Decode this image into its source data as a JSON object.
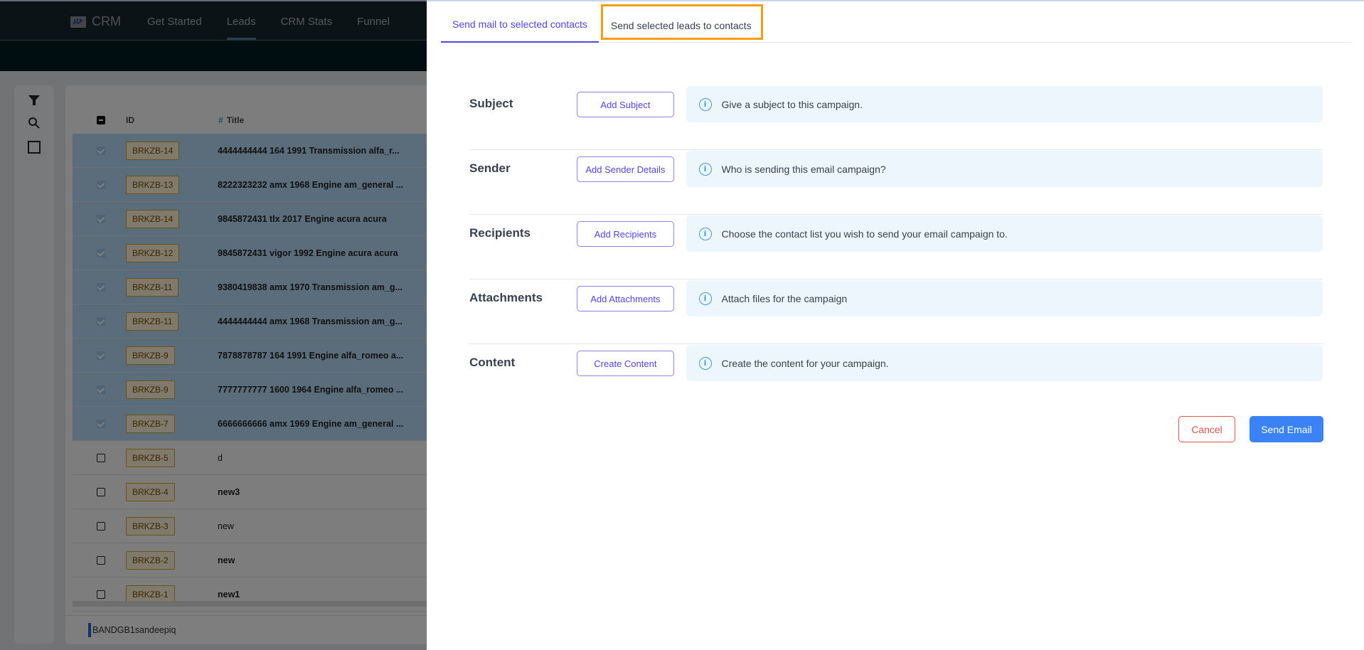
{
  "app": {
    "brand": "CRM",
    "nav": [
      {
        "label": "Get Started",
        "active": false
      },
      {
        "label": "Leads",
        "active": true
      },
      {
        "label": "CRM Stats",
        "active": false
      },
      {
        "label": "Funnel",
        "active": false
      }
    ]
  },
  "side_rail": {
    "icons": [
      "filter-icon",
      "search-icon",
      "square-icon"
    ]
  },
  "grid": {
    "columns": {
      "id": "ID",
      "title_hash": "#",
      "title": "Title"
    },
    "rows": [
      {
        "id": "BRKZB-14",
        "title": "4444444444 164 1991 Transmission alfa_r...",
        "selected": true,
        "bold": true
      },
      {
        "id": "BRKZB-13",
        "title": "8222323232 amx 1968 Engine am_general ...",
        "selected": true,
        "bold": true
      },
      {
        "id": "BRKZB-14",
        "title": "9845872431 tlx 2017 Engine acura acura",
        "selected": true,
        "bold": true
      },
      {
        "id": "BRKZB-12",
        "title": "9845872431 vigor 1992 Engine acura acura",
        "selected": true,
        "bold": true
      },
      {
        "id": "BRKZB-11",
        "title": "9380419838 amx 1970 Transmission am_g...",
        "selected": true,
        "bold": true
      },
      {
        "id": "BRKZB-11",
        "title": "4444444444 amx 1968 Transmission am_g...",
        "selected": true,
        "bold": true
      },
      {
        "id": "BRKZB-9",
        "title": "7878878787 164 1991 Engine alfa_romeo a...",
        "selected": true,
        "bold": true
      },
      {
        "id": "BRKZB-9",
        "title": "7777777777 1600 1964 Engine alfa_romeo ...",
        "selected": true,
        "bold": true
      },
      {
        "id": "BRKZB-7",
        "title": "6666666666 amx 1969 Engine am_general ...",
        "selected": true,
        "bold": true
      },
      {
        "id": "BRKZB-5",
        "title": "d",
        "selected": false,
        "bold": false
      },
      {
        "id": "BRKZB-4",
        "title": "new3",
        "selected": false,
        "bold": true
      },
      {
        "id": "BRKZB-3",
        "title": "new",
        "selected": false,
        "bold": false
      },
      {
        "id": "BRKZB-2",
        "title": "new",
        "selected": false,
        "bold": true
      },
      {
        "id": "BRKZB-1",
        "title": "new1",
        "selected": false,
        "bold": true
      }
    ],
    "footer": "BANDGB1sandeepiq"
  },
  "dialog": {
    "tabs": [
      {
        "label": "Send mail to selected contacts",
        "active": true
      },
      {
        "label": "Send selected leads to contacts",
        "active": false,
        "highlighted": true
      }
    ],
    "sections": [
      {
        "label": "Subject",
        "button": "Add Subject",
        "info": "Give a subject to this campaign."
      },
      {
        "label": "Sender",
        "button": "Add Sender Details",
        "info": "Who is sending this email campaign?"
      },
      {
        "label": "Recipients",
        "button": "Add Recipients",
        "info": "Choose the contact list you wish to send your email campaign to."
      },
      {
        "label": "Attachments",
        "button": "Add Attachments",
        "info": "Attach files for the campaign"
      },
      {
        "label": "Content",
        "button": "Create Content",
        "info": "Create the content for your campaign."
      }
    ],
    "info_glyph": "i",
    "cancel_label": "Cancel",
    "send_label": "Send Email"
  },
  "colors": {
    "accent": "#4f46e5",
    "highlight_outline": "#f59e0b",
    "send_button": "#3b82f6",
    "cancel": "#e05454",
    "info_bg": "#eef6fd",
    "id_badge_border": "#d4a430"
  }
}
